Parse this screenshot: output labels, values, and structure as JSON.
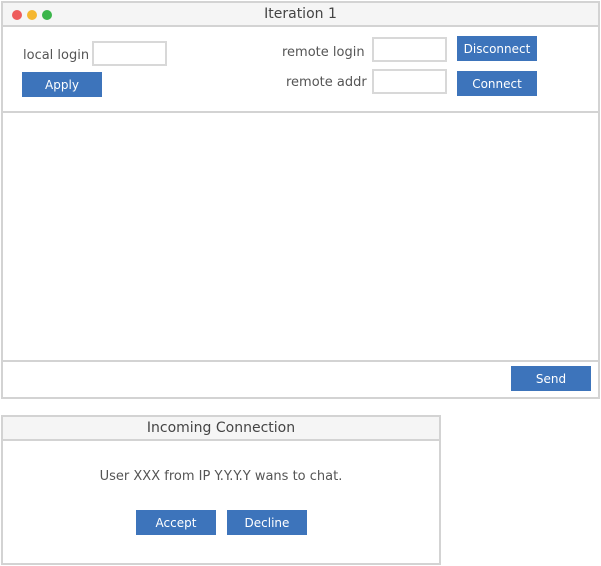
{
  "main_window": {
    "title": "Iteration 1",
    "window_controls": [
      "close",
      "minimize",
      "maximize"
    ],
    "local_login": {
      "label": "local login",
      "value": "",
      "placeholder": ""
    },
    "apply_label": "Apply",
    "remote_login": {
      "label": "remote login",
      "value": "",
      "placeholder": ""
    },
    "remote_addr": {
      "label": "remote addr",
      "value": "",
      "placeholder": ""
    },
    "disconnect_label": "Disconnect",
    "connect_label": "Connect",
    "message_input": {
      "value": "",
      "placeholder": ""
    },
    "send_label": "Send"
  },
  "dialog": {
    "title": "Incoming Connection",
    "message": "User XXX from IP Y.Y.Y.Y wans to chat.",
    "accept_label": "Accept",
    "decline_label": "Decline"
  },
  "colors": {
    "accent": "#3d74bb",
    "border": "#d3d3d3",
    "titlebar_bg": "#f5f5f5",
    "close": "#ee5c5c",
    "minimize": "#f5b731",
    "maximize": "#3bb54a"
  }
}
